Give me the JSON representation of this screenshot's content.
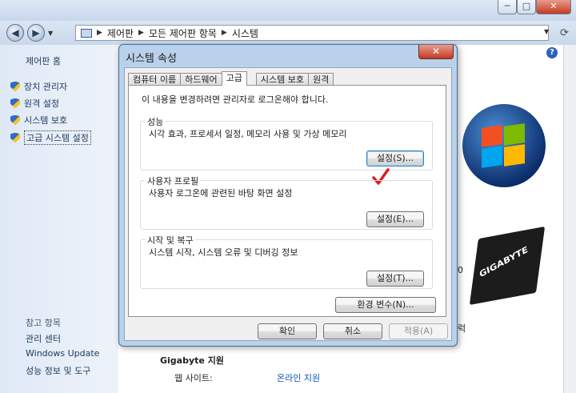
{
  "window": {
    "minimize_glyph": "─",
    "maximize_glyph": "□",
    "close_glyph": "✕"
  },
  "address": {
    "crumbs": [
      "제어판",
      "모든 제어판 항목",
      "시스템"
    ],
    "back_icon": "back-arrow-icon",
    "forward_icon": "forward-arrow-icon"
  },
  "sidebar": {
    "home": "제어판 홈",
    "items": [
      {
        "label": "장치 관리자"
      },
      {
        "label": "원격 설정"
      },
      {
        "label": "시스템 보호"
      },
      {
        "label": "고급 시스템 설정"
      }
    ],
    "see_also_header": "참고 항목",
    "see_also": [
      "관리 센터",
      "Windows Update",
      "성능 정보 및 도구"
    ]
  },
  "background": {
    "help_glyph": "?",
    "chip_label": "GIGABYTE",
    "fragment_0": "0",
    "fragment_rek": "럭",
    "support_header": "Gigabyte 지원",
    "website_label": "웹 사이트:",
    "online_support": "온라인 지원"
  },
  "dialog": {
    "title": "시스템 속성",
    "close_glyph": "✕",
    "tabs": [
      "컴퓨터 이름",
      "하드웨어",
      "고급",
      "시스템 보호",
      "원격"
    ],
    "active_tab": "고급",
    "admin_note": "이 내용을 변경하려면 관리자로 로그온해야 합니다.",
    "groups": [
      {
        "title": "성능",
        "desc": "시각 효과, 프로세서 일정, 메모리 사용 및 가상 메모리",
        "button": "설정(S)..."
      },
      {
        "title": "사용자 프로필",
        "desc": "사용자 로그온에 관련된 바탕 화면 설정",
        "button": "설정(E)..."
      },
      {
        "title": "시작 및 복구",
        "desc": "시스템 시작, 시스템 오류 및 디버깅 정보",
        "button": "설정(T)..."
      }
    ],
    "env_button": "환경 변수(N)...",
    "ok": "확인",
    "cancel": "취소",
    "apply": "적용(A)"
  },
  "colors": {
    "accent_check": "#d91f1f",
    "link": "#0a55b6"
  }
}
